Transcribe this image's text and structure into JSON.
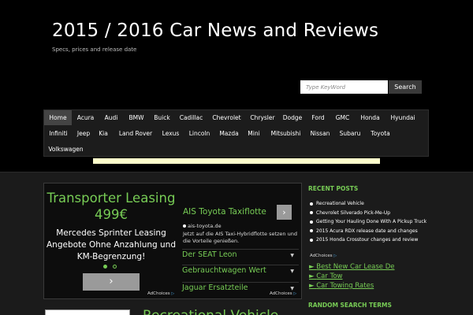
{
  "header": {
    "title": "2015 / 2016 Car News and Reviews",
    "description": "Specs, prices and release date"
  },
  "search": {
    "placeholder": "Type KeyWord",
    "button_label": "Search"
  },
  "nav": {
    "items": [
      "Home",
      "Acura",
      "Audi",
      "BMW",
      "Buick",
      "Cadillac",
      "Chevrolet",
      "Chrysler",
      "Dodge",
      "Ford",
      "GMC",
      "Honda",
      "Hyundai",
      "Infiniti",
      "Jeep",
      "Kia",
      "Land Rover",
      "Lexus",
      "Lincoln",
      "Mazda",
      "Mini",
      "Mitsubishi",
      "Nissan",
      "Subaru",
      "Toyota",
      "Volkswagen"
    ],
    "active": "Home"
  },
  "ad": {
    "left_title": "Transporter Leasing 499€",
    "left_desc": "Mercedes Sprinter Leasing Angebote Ohne Anzahlung und KM-Begrenzung!",
    "arrow_glyph": "›",
    "right_title": "AIS Toyota Taxiflotte",
    "right_url": "ais-toyota.de",
    "right_desc": "Jetzt auf die AIS Taxi-Hybridflotte setzen und die Vorteile genießen.",
    "links": [
      "Der SEAT Leon",
      "Gebrauchtwagen Wert",
      "Jaguar Ersatzteile"
    ],
    "adchoices": "AdChoices"
  },
  "sidebar": {
    "recent_title": "RECENT POSTS",
    "recent_posts": [
      "Recreational Vehicle",
      "Chevrolet Silverado Pick-Me-Up",
      "Getting Your Hauling Done With A Pickup Truck",
      "2015 Acura RDX release date and changes",
      "2015 Honda Crosstour changes and review"
    ],
    "adchoices": "AdChoices",
    "ad_links": [
      "Best New Car Lease De",
      "Car Tow",
      "Car Towing Rates"
    ],
    "random_title": "RANDOM SEARCH TERMS"
  },
  "post": {
    "title": "Recreational Vehicle"
  },
  "colors": {
    "accent_green": "#77cc55",
    "background": "#000000",
    "nav_active": "#444444"
  }
}
